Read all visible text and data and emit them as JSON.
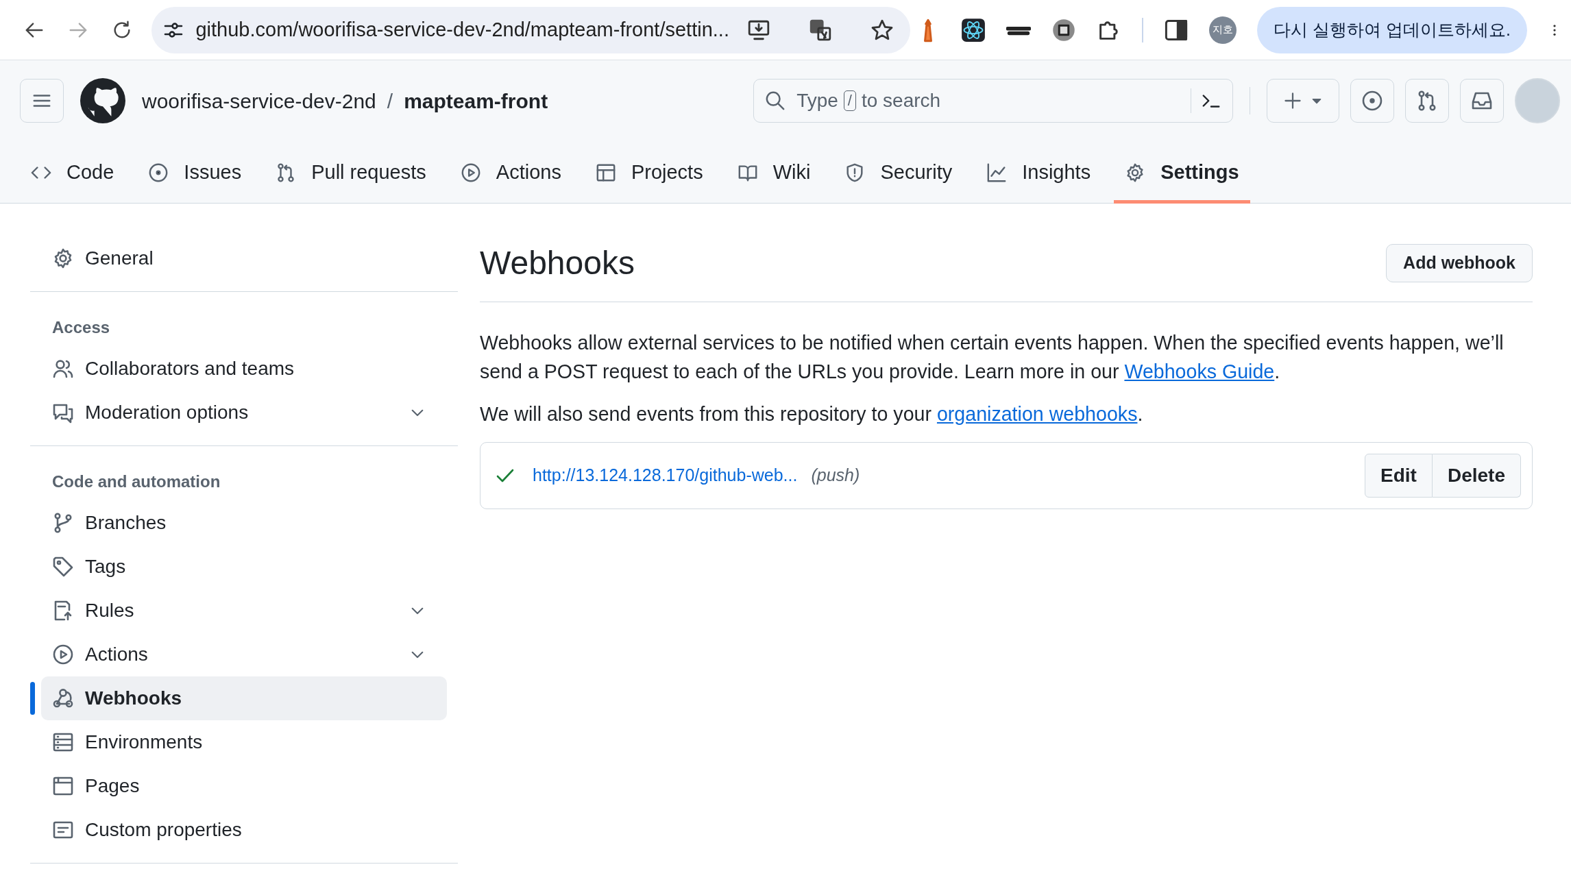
{
  "browser": {
    "url": "github.com/woorifisa-service-dev-2nd/mapteam-front/settin...",
    "profile": "지호",
    "update_notice": "다시 실행하여 업데이트하세요."
  },
  "header": {
    "owner": "woorifisa-service-dev-2nd",
    "separator": "/",
    "repo": "mapteam-front",
    "search": {
      "before": "Type",
      "key": "/",
      "after": "to search"
    }
  },
  "tabs": [
    {
      "label": "Code",
      "selected": false
    },
    {
      "label": "Issues",
      "selected": false
    },
    {
      "label": "Pull requests",
      "selected": false
    },
    {
      "label": "Actions",
      "selected": false
    },
    {
      "label": "Projects",
      "selected": false
    },
    {
      "label": "Wiki",
      "selected": false
    },
    {
      "label": "Security",
      "selected": false
    },
    {
      "label": "Insights",
      "selected": false
    },
    {
      "label": "Settings",
      "selected": true
    }
  ],
  "sidebar": {
    "sections": [
      {
        "items": [
          {
            "label": "General",
            "expandable": false,
            "selected": false
          }
        ]
      },
      {
        "title": "Access",
        "items": [
          {
            "label": "Collaborators and teams",
            "expandable": false,
            "selected": false
          },
          {
            "label": "Moderation options",
            "expandable": true,
            "selected": false
          }
        ]
      },
      {
        "title": "Code and automation",
        "items": [
          {
            "label": "Branches",
            "expandable": false,
            "selected": false
          },
          {
            "label": "Tags",
            "expandable": false,
            "selected": false
          },
          {
            "label": "Rules",
            "expandable": true,
            "selected": false
          },
          {
            "label": "Actions",
            "expandable": true,
            "selected": false
          },
          {
            "label": "Webhooks",
            "expandable": false,
            "selected": true
          },
          {
            "label": "Environments",
            "expandable": false,
            "selected": false
          },
          {
            "label": "Pages",
            "expandable": false,
            "selected": false
          },
          {
            "label": "Custom properties",
            "expandable": false,
            "selected": false
          }
        ]
      }
    ]
  },
  "main": {
    "title": "Webhooks",
    "add_button": "Add webhook",
    "paragraphs": [
      {
        "before": "Webhooks allow external services to be notified when certain events happen. When the specified events happen, we’ll send a POST request to each of the URLs you provide. Learn more in our ",
        "link": "Webhooks Guide",
        "after": "."
      },
      {
        "before": "We will also send events from this repository to your ",
        "link": "organization webhooks",
        "after": "."
      }
    ],
    "webhooks": [
      {
        "url": "http://13.124.128.170/github-web...",
        "events": "(push)",
        "ok": true,
        "actions": [
          "Edit",
          "Delete"
        ]
      }
    ]
  }
}
